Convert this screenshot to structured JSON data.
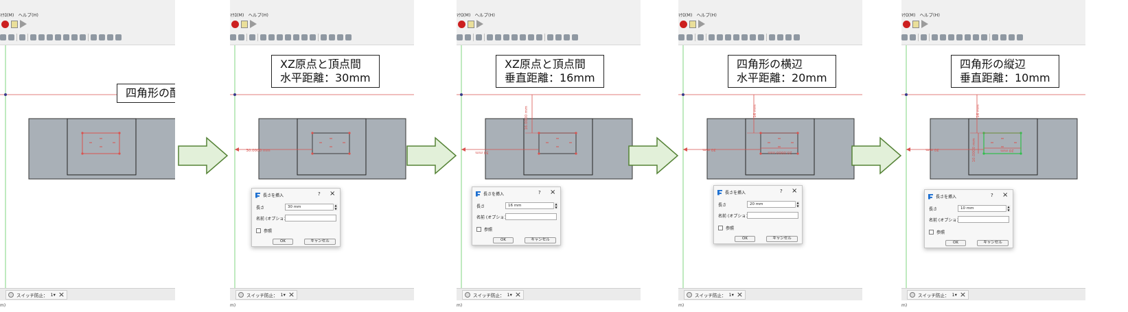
{
  "app": {
    "menu": [
      "ﾏｸﾛ(M)",
      "ヘルプ(H)"
    ],
    "status_tab_label": "スイッチ防止：",
    "status_tab_suffix": "1▾",
    "bottom_text": "m)"
  },
  "panels": [
    {
      "callout": [
        "四角形の配置"
      ],
      "dimension_texts": [],
      "dialog": null
    },
    {
      "callout": [
        "XZ原点と頂点間",
        "水平距離：30mm"
      ],
      "dimension_texts": [
        "30.0000 mm"
      ],
      "dialog": {
        "title": "長さを挿入",
        "length_label": "長さ",
        "length_value": "30 mm",
        "name_label": "名前 (オプション)",
        "reference_label": "参照",
        "ok": "OK",
        "cancel": "キャンセル"
      }
    },
    {
      "callout": [
        "XZ原点と頂点間",
        "垂直距離：16mm"
      ],
      "dimension_texts": [
        "30 mm",
        "16.0000 mm"
      ],
      "dialog": {
        "title": "長さを挿入",
        "length_label": "長さ",
        "length_value": "16 mm",
        "name_label": "名前 (オプション)",
        "reference_label": "参照",
        "ok": "OK",
        "cancel": "キャンセル"
      }
    },
    {
      "callout": [
        "四角形の横辺",
        "水平距離：20mm"
      ],
      "dimension_texts": [
        "30 mm",
        "16 mm",
        "20.0000 mm"
      ],
      "dialog": {
        "title": "長さを挿入",
        "length_label": "長さ",
        "length_value": "20 mm",
        "name_label": "名前 (オプション)",
        "reference_label": "参照",
        "ok": "OK",
        "cancel": "キャンセル"
      }
    },
    {
      "callout": [
        "四角形の縦辺",
        "垂直距離：10mm"
      ],
      "dimension_texts": [
        "30 mm",
        "16 mm",
        "20 mm",
        "10.0000 mm"
      ],
      "dialog": {
        "title": "長さを挿入",
        "length_label": "長さ",
        "length_value": "10 mm",
        "name_label": "名前 (オプション)",
        "reference_label": "参照",
        "ok": "OK",
        "cancel": "キャンセル"
      }
    }
  ],
  "colors": {
    "part_fill": "#a9b0b7",
    "constraint_red": "#d9534f",
    "axis_green": "#7fd47f",
    "arrow_fill": "#e2f0d9",
    "arrow_stroke": "#548235"
  }
}
